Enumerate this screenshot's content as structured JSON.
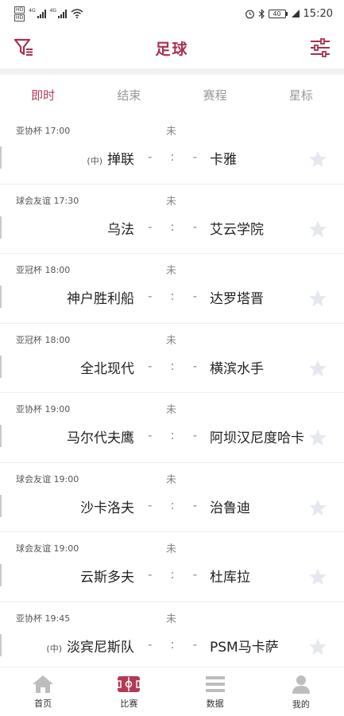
{
  "status_bar": {
    "sim1": "HD",
    "sim2": "HD",
    "net1": "4G",
    "net2": "4G",
    "battery": "40",
    "time": "15:20"
  },
  "header": {
    "title": "足球",
    "accent_color": "#a8324f"
  },
  "tabs": [
    {
      "label": "即时",
      "active": true
    },
    {
      "label": "结束",
      "active": false
    },
    {
      "label": "赛程",
      "active": false
    },
    {
      "label": "星标",
      "active": false
    }
  ],
  "matches": [
    {
      "league": "亚协杯 17:00",
      "status": "未",
      "home_tag": "(中)",
      "home": "掸联",
      "score_home": "-",
      "score_sep": ":",
      "score_away": "-",
      "away": "卡雅"
    },
    {
      "league": "球会友谊 17:30",
      "status": "未",
      "home_tag": "",
      "home": "乌法",
      "score_home": "-",
      "score_sep": ":",
      "score_away": "-",
      "away": "艾云学院"
    },
    {
      "league": "亚冠杯 18:00",
      "status": "未",
      "home_tag": "",
      "home": "神户胜利船",
      "score_home": "-",
      "score_sep": ":",
      "score_away": "-",
      "away": "达罗塔晋"
    },
    {
      "league": "亚冠杯 18:00",
      "status": "未",
      "home_tag": "",
      "home": "全北现代",
      "score_home": "-",
      "score_sep": ":",
      "score_away": "-",
      "away": "横滨水手"
    },
    {
      "league": "亚协杯 19:00",
      "status": "未",
      "home_tag": "",
      "home": "马尔代夫鹰",
      "score_home": "-",
      "score_sep": ":",
      "score_away": "-",
      "away": "阿坝汉尼度哈卡"
    },
    {
      "league": "球会友谊 19:00",
      "status": "未",
      "home_tag": "",
      "home": "沙卡洛夫",
      "score_home": "-",
      "score_sep": ":",
      "score_away": "-",
      "away": "治鲁迪"
    },
    {
      "league": "球会友谊 19:00",
      "status": "未",
      "home_tag": "",
      "home": "云斯多夫",
      "score_home": "-",
      "score_sep": ":",
      "score_away": "-",
      "away": "杜库拉"
    },
    {
      "league": "亚协杯 19:45",
      "status": "未",
      "home_tag": "(中)",
      "home": "淡宾尼斯队",
      "score_home": "-",
      "score_sep": ":",
      "score_away": "-",
      "away": "PSM马卡萨"
    }
  ],
  "bottom_nav": [
    {
      "label": "首页",
      "icon": "home-icon"
    },
    {
      "label": "比赛",
      "icon": "match-icon",
      "active": true
    },
    {
      "label": "数据",
      "icon": "data-icon"
    },
    {
      "label": "我的",
      "icon": "profile-icon"
    }
  ]
}
